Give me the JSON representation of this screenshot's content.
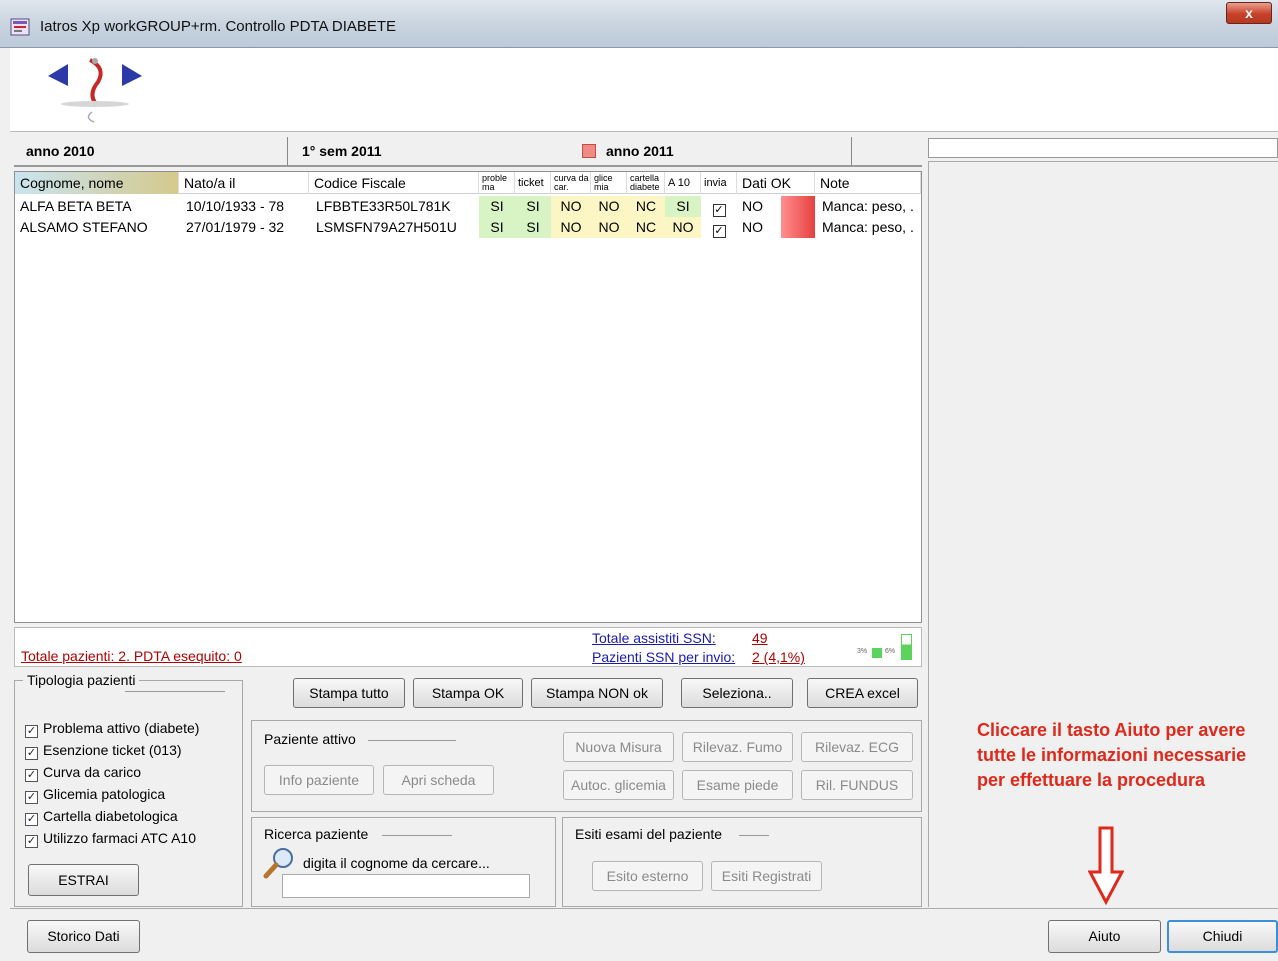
{
  "window": {
    "title": "Iatros Xp workGROUP+rm. Controllo PDTA DIABETE",
    "close_glyph": "x"
  },
  "tabs": [
    {
      "label": "anno 2010"
    },
    {
      "label": "1° sem 2011"
    },
    {
      "label": "anno 2011"
    }
  ],
  "table": {
    "headers": [
      "Cognome, nome",
      "Nato/a il",
      "Codice Fiscale",
      "proble ma",
      "ticket",
      "curva da car.",
      "glice mia",
      "cartella diabete",
      "A 10",
      "invia",
      "Dati OK",
      "Note"
    ],
    "rows": [
      {
        "name": "ALFA BETA BETA",
        "born": "10/10/1933 - 78",
        "cf": "LFBBTE33R50L781K",
        "problema": "SI",
        "ticket": "SI",
        "curva": "NO",
        "glicemia": "NO",
        "cartella": "NC",
        "a10": "SI",
        "invia": "✓",
        "dati_ok": "NO",
        "note": "Manca: peso, ."
      },
      {
        "name": "ALSAMO STEFANO",
        "born": "27/01/1979 - 32",
        "cf": "LSMSFN79A27H501U",
        "problema": "SI",
        "ticket": "SI",
        "curva": "NO",
        "glicemia": "NO",
        "cartella": "NC",
        "a10": "NO",
        "invia": "✓",
        "dati_ok": "NO",
        "note": "Manca: peso, ."
      }
    ]
  },
  "totals": {
    "pazienti": "Totale pazienti: 2. PDTA esequito: 0",
    "assistiti_label": "Totale assistiti SSN:",
    "assistiti_value": "49",
    "invio_label": "Pazienti SSN per invio:",
    "invio_value": "2 (4,1%)",
    "mini_label_left": "3%",
    "mini_label_right": "6%"
  },
  "tipologia": {
    "legend": "Tipologia pazienti",
    "items": [
      {
        "label": "Problema attivo (diabete)",
        "checked": "✓"
      },
      {
        "label": "Esenzione ticket (013)",
        "checked": "✓"
      },
      {
        "label": "Curva da carico",
        "checked": "✓"
      },
      {
        "label": "Glicemia patologica",
        "checked": "✓"
      },
      {
        "label": "Cartella diabetologica",
        "checked": "✓"
      },
      {
        "label": "Utilizzo farmaci ATC A10",
        "checked": "✓"
      }
    ],
    "estrai": "ESTRAI"
  },
  "actions": {
    "stampa_tutto": "Stampa tutto",
    "stampa_ok": "Stampa OK",
    "stampa_non_ok": "Stampa NON ok",
    "seleziona": "Seleziona..",
    "crea_excel": "CREA excel"
  },
  "paziente_attivo": {
    "legend": "Paziente attivo",
    "info": "Info paziente",
    "apri": "Apri scheda",
    "nuova_misura": "Nuova Misura",
    "rilevaz_fumo": "Rilevaz. Fumo",
    "rilevaz_ecg": "Rilevaz. ECG",
    "autoc_glicemia": "Autoc. glicemia",
    "esame_piede": "Esame piede",
    "ril_fundus": "Ril. FUNDUS"
  },
  "ricerca": {
    "legend": "Ricerca paziente",
    "hint": "digita il cognome da cercare...",
    "value": ""
  },
  "esiti": {
    "legend": "Esiti esami del paziente",
    "esterno": "Esito esterno",
    "registrati": "Esiti Registrati"
  },
  "note": "Cliccare il tasto Aiuto per avere tutte le informazioni necessarie per effettuare la procedura",
  "footer": {
    "storico": "Storico Dati",
    "aiuto": "Aiuto",
    "chiudi": "Chiudi"
  },
  "colors": {
    "ok_green": "#d8f3c4",
    "warn_yellow": "#fbf6c4",
    "alert_red": "#e0281b",
    "link_blue": "#1a1ab5"
  }
}
